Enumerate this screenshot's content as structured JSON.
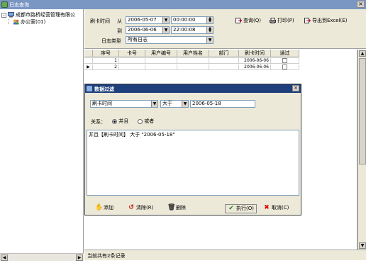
{
  "window": {
    "title": "日志查询",
    "close_icon": "×"
  },
  "tree": {
    "root_label": "成都市路桥经营管理有限公",
    "child_label": "办公室(01)",
    "expander": "-"
  },
  "filter_panel": {
    "swipe_time_label": "刷卡时间",
    "from_label": "从",
    "to_label": "到",
    "from_date": "2006-05-07",
    "from_time": "00:00:00",
    "to_date": "2006-06-06",
    "to_time": "22:00:08",
    "log_type_label": "日志类型",
    "log_type_value": "所有日志"
  },
  "toolbar": {
    "query_label": "查询(Q)",
    "print_label": "打印(P)",
    "export_label": "导出到Excel(E)"
  },
  "table": {
    "columns": [
      "序号",
      "卡号",
      "用户编号",
      "用户姓名",
      "部门",
      "刷卡时间",
      "通过"
    ],
    "rows": [
      {
        "index": "1",
        "card": "",
        "user_no": "",
        "user_name": "",
        "dept": "",
        "time": "2006-06-06",
        "passed": false
      },
      {
        "index": "2",
        "card": "",
        "user_no": "",
        "user_name": "",
        "dept": "",
        "time": "2006-06-06",
        "passed": false
      }
    ]
  },
  "status_bar": {
    "text": "当前共有2条记录"
  },
  "dialog": {
    "title": "数据过滤",
    "field_value": "刷卡时间",
    "operator_value": "大于",
    "compare_value": "2006-05-18",
    "relation_label": "关系：",
    "and_label": "并且",
    "or_label": "或者",
    "expression": "并且【刷卡时间】 大于 \"2006-05-18\"",
    "add_label": "添加",
    "clear_label": "清除(R)",
    "delete_label": "删除",
    "execute_label": "执行(O)",
    "cancel_label": "取消(C)"
  },
  "colors": {
    "title_bar": "#7a96c2",
    "dialog_title": "#1f3f7c",
    "panel_bg": "#ece9d8"
  }
}
